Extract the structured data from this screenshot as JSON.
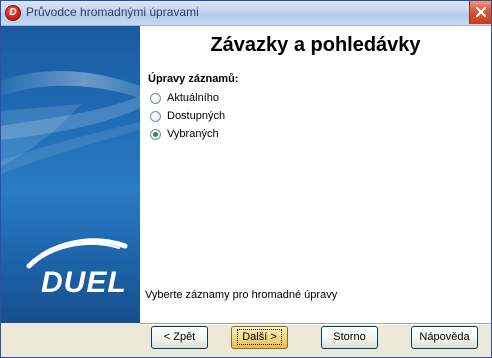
{
  "window": {
    "title": "Průvodce hromadnými úpravami",
    "icon_letter": "D"
  },
  "sidebar": {
    "logo_text": "DUEL"
  },
  "main": {
    "heading": "Závazky a pohledávky",
    "group_label": "Úpravy záznamů:",
    "options": [
      {
        "label": "Aktuálního",
        "checked": false
      },
      {
        "label": "Dostupných",
        "checked": false
      },
      {
        "label": "Vybraných",
        "checked": true
      }
    ],
    "hint": "Vyberte záznamy pro hromadné úpravy"
  },
  "buttons": {
    "back": "< Zpět",
    "next": "Další >",
    "cancel": "Storno",
    "help": "Nápověda"
  },
  "colors": {
    "sidebar_blue": "#1f6bb4",
    "close_red": "#de5a3a",
    "default_button": "#f7d982"
  }
}
